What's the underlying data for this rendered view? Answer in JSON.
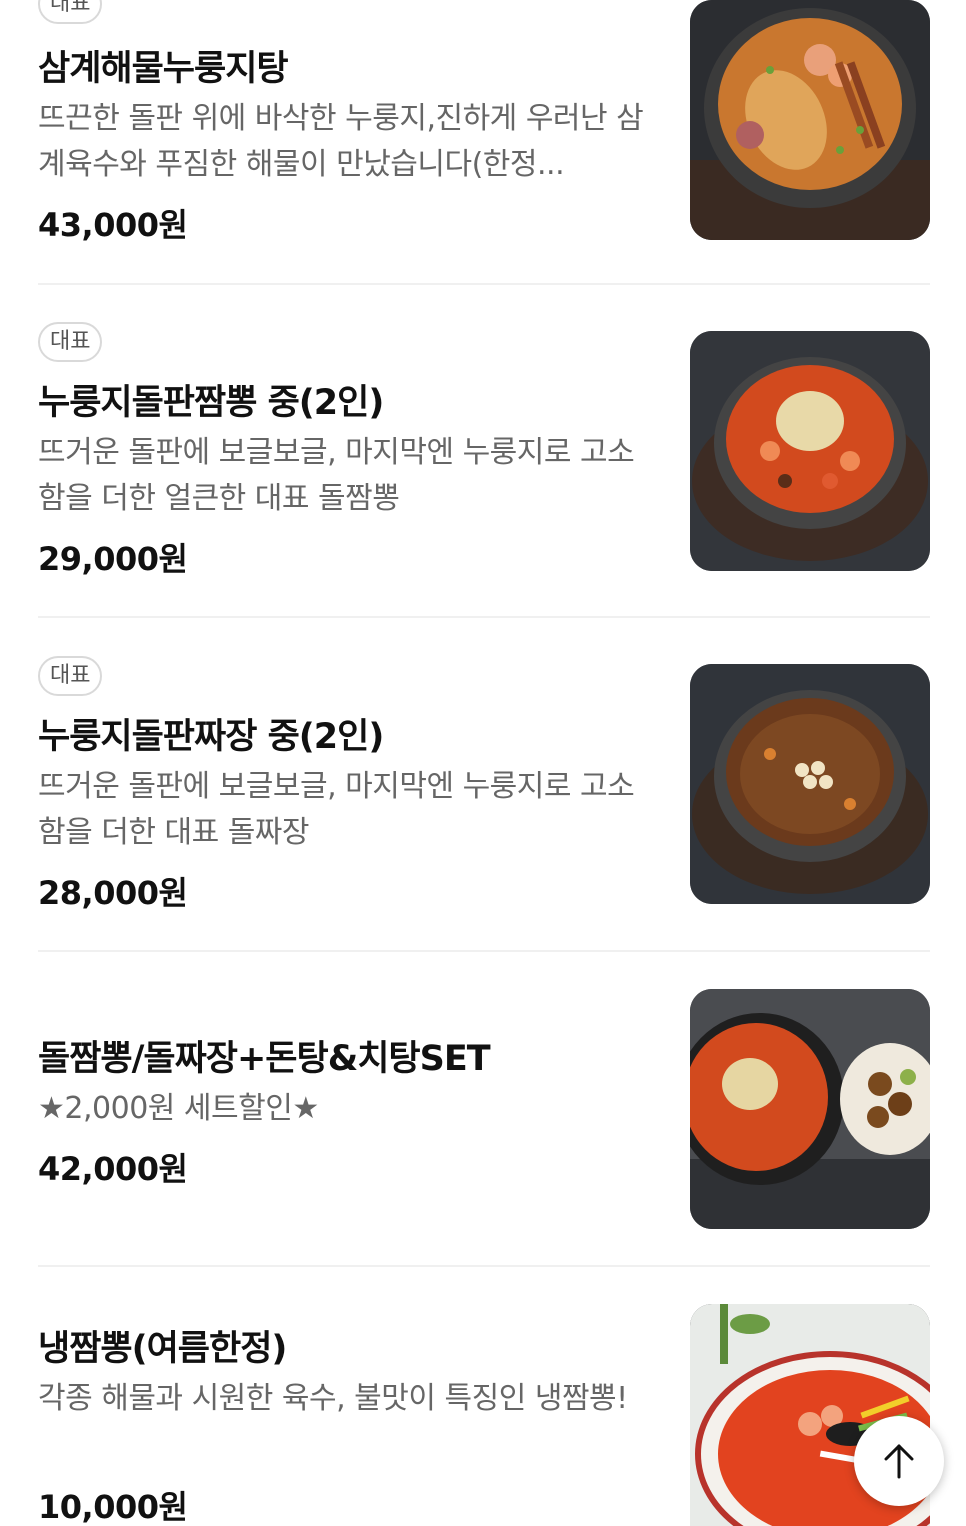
{
  "menu": {
    "items": [
      {
        "badge": "대표",
        "name": "삼계해물누룽지탕",
        "description": "뜨끈한 돌판 위에 바삭한 누룽지,진하게 우러난 삼계육수와 푸짐한 해물이 만났습니다(한정...",
        "price": "43,000원",
        "image": "samgye-seafood-nurungji-soup-photo"
      },
      {
        "badge": "대표",
        "name": "누룽지돌판짬뽕 중(2인)",
        "description": "뜨거운 돌판에 보글보글, 마지막엔 누룽지로 고소함을 더한 얼큰한 대표 돌짬뽕",
        "price": "29,000원",
        "image": "nurungji-stone-jjamppong-photo"
      },
      {
        "badge": "대표",
        "name": "누룽지돌판짜장 중(2인)",
        "description": "뜨거운 돌판에 보글보글, 마지막엔 누룽지로 고소함을 더한 대표 돌짜장",
        "price": "28,000원",
        "image": "nurungji-stone-jjajang-photo"
      },
      {
        "name": "돌짬뽕/돌짜장+돈탕&치탕SET",
        "description": "★2,000원 세트할인★",
        "price": "42,000원",
        "image": "set-meal-photo"
      },
      {
        "name": "냉짬뽕(여름한정)",
        "description": "각종 해물과 시원한 육수, 불맛이 특징인 냉짬뽕!",
        "price": "10,000원",
        "image": "cold-jjamppong-photo"
      }
    ]
  },
  "scroll_top": {
    "icon": "arrow-up-icon"
  },
  "colors": {
    "text": "#111111",
    "description": "#666666",
    "badge_border": "#d9d9d9",
    "divider": "#f0f0f0"
  }
}
